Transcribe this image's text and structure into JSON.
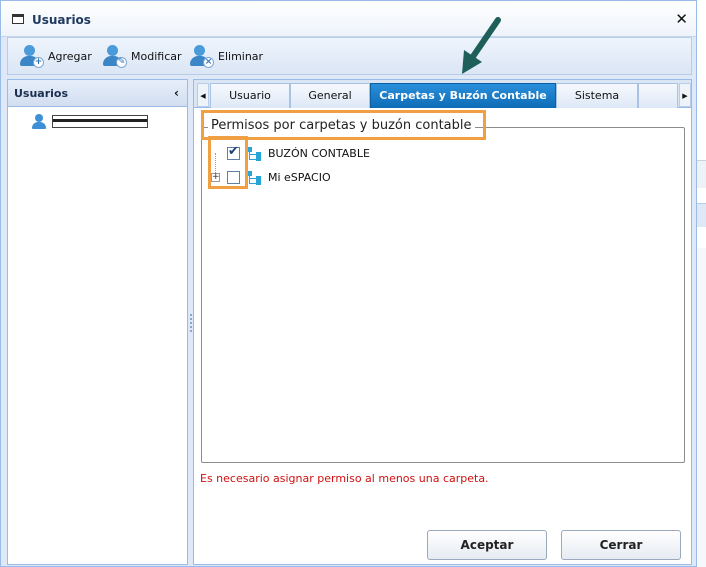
{
  "window": {
    "title": "Usuarios"
  },
  "toolbar": {
    "add_label": "Agregar",
    "edit_label": "Modificar",
    "delete_label": "Eliminar"
  },
  "left_panel": {
    "title": "Usuarios"
  },
  "tabs": [
    {
      "label": "Usuario",
      "active": false
    },
    {
      "label": "General",
      "active": false
    },
    {
      "label": "Carpetas y Buzón Contable",
      "active": true
    },
    {
      "label": "Sistema",
      "active": false
    }
  ],
  "permissions": {
    "legend": "Permisos por carpetas y buzón contable",
    "nodes": [
      {
        "label": "BUZÓN CONTABLE",
        "checked": true
      },
      {
        "label": "Mi eSPACIO",
        "checked": false
      }
    ]
  },
  "error_message": "Es necesario asignar permiso al menos una carpeta.",
  "buttons": {
    "accept": "Aceptar",
    "close": "Cerrar"
  },
  "colors": {
    "active_tab": "#0e6cb6",
    "highlight": "#f0a043",
    "error": "#d01010",
    "arrow": "#1f5f5a"
  }
}
